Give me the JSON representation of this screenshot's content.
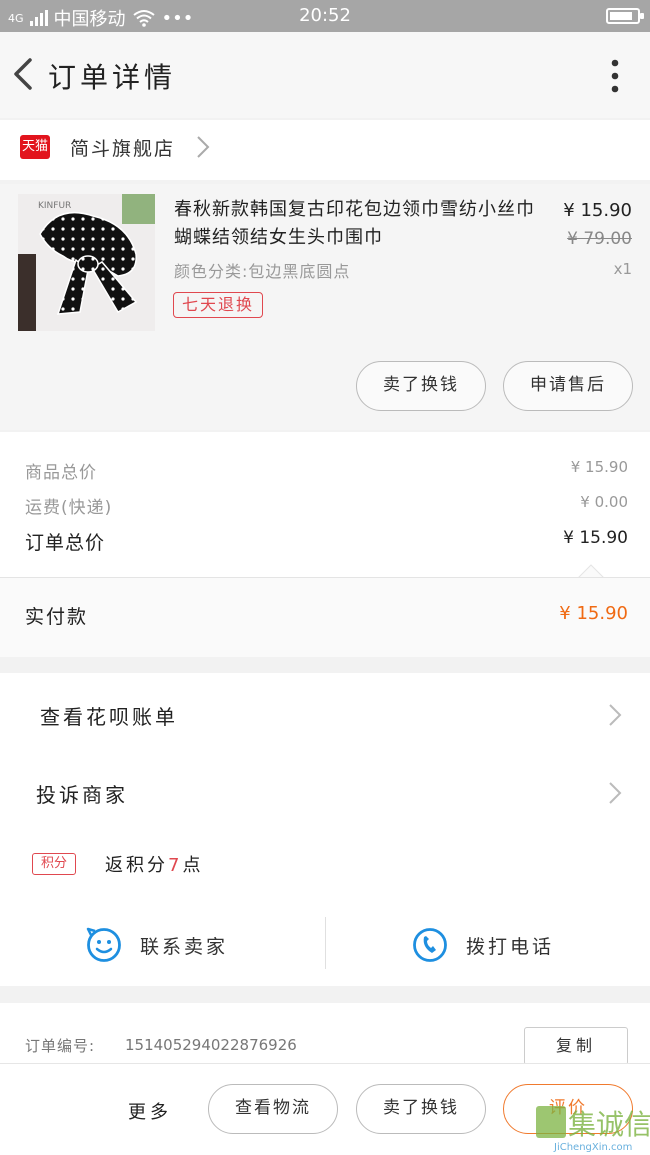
{
  "status_bar": {
    "network": "4G",
    "carrier": "中国移动",
    "dots": "•••",
    "time": "20:52"
  },
  "header": {
    "title": "订单详情"
  },
  "store": {
    "badge": "天猫",
    "name": "简斗旗舰店"
  },
  "item": {
    "title": "春秋新款韩国复古印花包边领巾雪纺小丝巾蝴蝶结领结女生头巾围巾",
    "spec": "颜色分类:包边黑底圆点",
    "return_badge": "七天退换",
    "price": "¥ 15.90",
    "original_price": "¥ 79.00",
    "quantity": "x1",
    "image_label": "KINFUR",
    "buttons": [
      "卖了换钱",
      "申请售后"
    ]
  },
  "totals": {
    "goods_label": "商品总价",
    "goods_value": "¥ 15.90",
    "shipping_label": "运费(快递)",
    "shipping_value": "¥ 0.00",
    "order_total_label": "订单总价",
    "order_total_value": "¥ 15.90",
    "paid_label": "实付款",
    "paid_value": "¥ 15.90"
  },
  "menu": {
    "huabei": "查看花呗账单",
    "complain": "投诉商家",
    "points_badge": "积分",
    "points_prefix": "返积分",
    "points_value": "7",
    "points_suffix": "点",
    "contact_seller": "联系卖家",
    "call_phone": "拨打电话"
  },
  "order": {
    "label": "订单编号:",
    "number": "151405294022876926",
    "copy": "复制"
  },
  "bottom_bar": {
    "more": "更多",
    "logistics": "查看物流",
    "sell": "卖了换钱",
    "review": "评价"
  },
  "watermark": {
    "brand": "集诚信",
    "url": "JiChengXin.com"
  },
  "colors": {
    "accent_orange": "#f06a13",
    "badge_red": "#e0484f",
    "tmall_red": "#e2141d",
    "contact_blue": "#1e8fe0"
  }
}
